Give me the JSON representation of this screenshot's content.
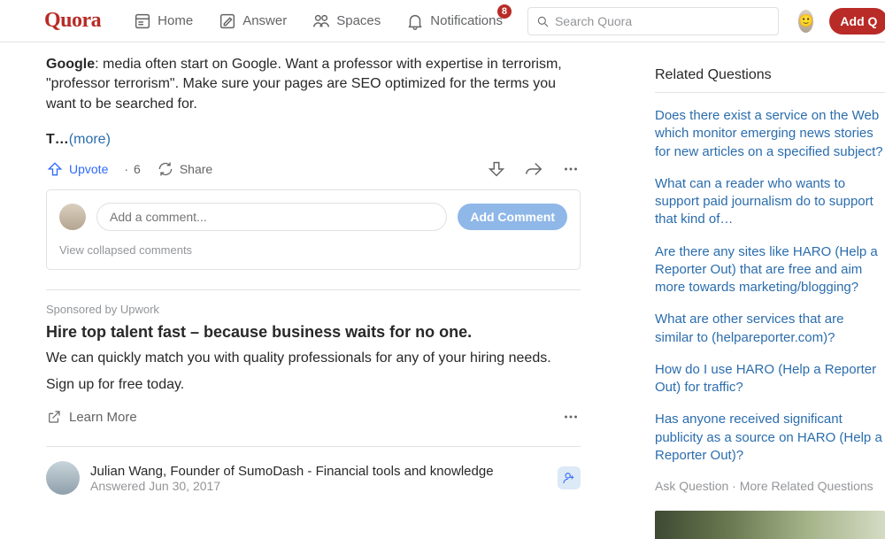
{
  "header": {
    "logo": "Quora",
    "nav": {
      "home": "Home",
      "answer": "Answer",
      "spaces": "Spaces",
      "notifications": "Notifications",
      "badge": "8"
    },
    "search_placeholder": "Search Quora",
    "add_question": "Add Q"
  },
  "answer": {
    "bold_lead": "Google",
    "body": ": media often start on Google. Want a professor with expertise in terrorism, \"professor terrorism\". Make sure your pages are SEO optimized for the terms you want to be searched for.",
    "truncated": "T…",
    "more": "(more)",
    "upvote_label": "Upvote",
    "upvote_count": "6",
    "share_label": "Share"
  },
  "comments": {
    "placeholder": "Add a comment...",
    "add_button": "Add Comment",
    "view_collapsed": "View collapsed comments"
  },
  "promo": {
    "sponsored": "Sponsored by Upwork",
    "title": "Hire top talent fast – because business waits for no one.",
    "body1": "We can quickly match you with quality professionals for any of your hiring needs.",
    "body2": "Sign up for free today.",
    "learn_more": "Learn More"
  },
  "answer2": {
    "author": "Julian Wang, Founder of SumoDash - Financial tools and knowledge",
    "answered": "Answered Jun 30, 2017"
  },
  "sidebar": {
    "title": "Related Questions",
    "items": [
      "Does there exist a service on the Web which monitor emerging news stories for new articles on a specified subject?",
      "What can a reader who wants to support paid journalism do to support that kind of…",
      "Are there any sites like HARO (Help a Reporter Out) that are free and aim more towards marketing/blogging?",
      "What are other services that are similar to (helpareporter.com)?",
      "How do I use HARO (Help a Reporter Out) for traffic?",
      "Has anyone received significant publicity as a source on HARO (Help a Reporter Out)?"
    ],
    "ask": "Ask Question",
    "more": "More Related Questions"
  }
}
